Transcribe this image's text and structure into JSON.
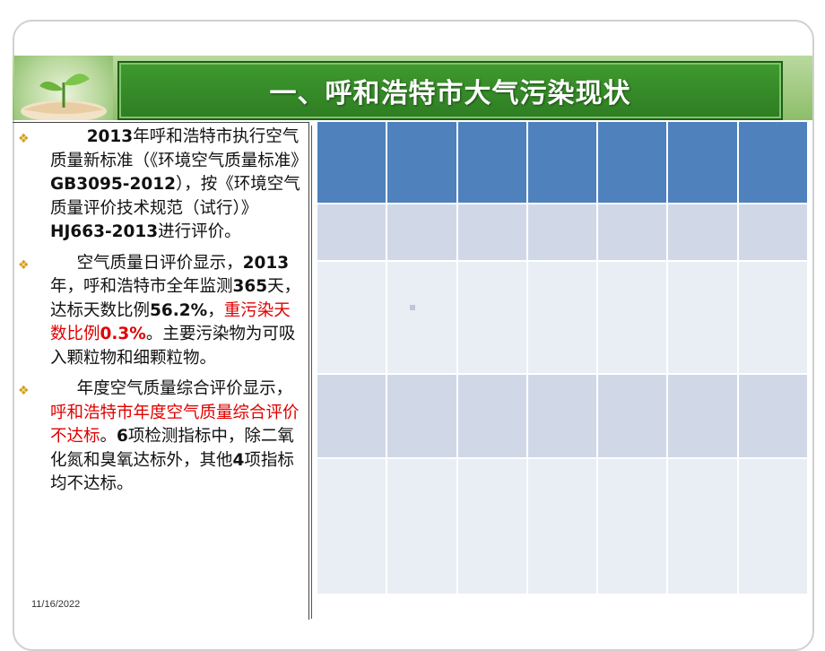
{
  "slide": {
    "title": "一、呼和浩特市大气污染现状",
    "date": "11/16/2022"
  },
  "bullets": [
    {
      "parts": [
        {
          "text": "2013",
          "bold": true
        },
        {
          "text": "年呼和浩特市执行空气质量新标准（《环境空气质量标准》"
        },
        {
          "text": "GB3095-2012",
          "bold": true
        },
        {
          "text": "），按《环境空气质量评价技术规范（试行）》"
        },
        {
          "text": "HJ663-2013",
          "bold": true
        },
        {
          "text": "进行评价。"
        }
      ]
    },
    {
      "parts": [
        {
          "text": "空气质量日评价显示，"
        },
        {
          "text": "2013",
          "bold": true
        },
        {
          "text": "年，呼和浩特市全年监测"
        },
        {
          "text": "365",
          "bold": true
        },
        {
          "text": "天，达标天数比例"
        },
        {
          "text": "56.2%",
          "bold": true
        },
        {
          "text": "，"
        },
        {
          "text": "重污染天数比例",
          "red": true
        },
        {
          "text": "0.3%",
          "bold": true,
          "red": true
        },
        {
          "text": "。主要污染物为可吸入颗粒物和细颗粒物。"
        }
      ]
    },
    {
      "parts": [
        {
          "text": "年度空气质量综合评价显示，"
        },
        {
          "text": "呼和浩特市年度空气质量综合评价不达标",
          "red": true
        },
        {
          "text": "。"
        },
        {
          "text": "6",
          "bold": true
        },
        {
          "text": "项检测指标中，除二氧化氮和臭氧达标外，其他"
        },
        {
          "text": "4",
          "bold": true
        },
        {
          "text": "项指标均不达标。"
        }
      ]
    }
  ],
  "table": {
    "rows": 5,
    "cols": 7
  },
  "colors": {
    "title_green": "#2e7d22",
    "header_blue": "#4f81bd",
    "band": "#d0d8e8",
    "band_light": "#e9edf4",
    "highlight_red": "#e00000",
    "bullet_gold": "#d4a017"
  }
}
